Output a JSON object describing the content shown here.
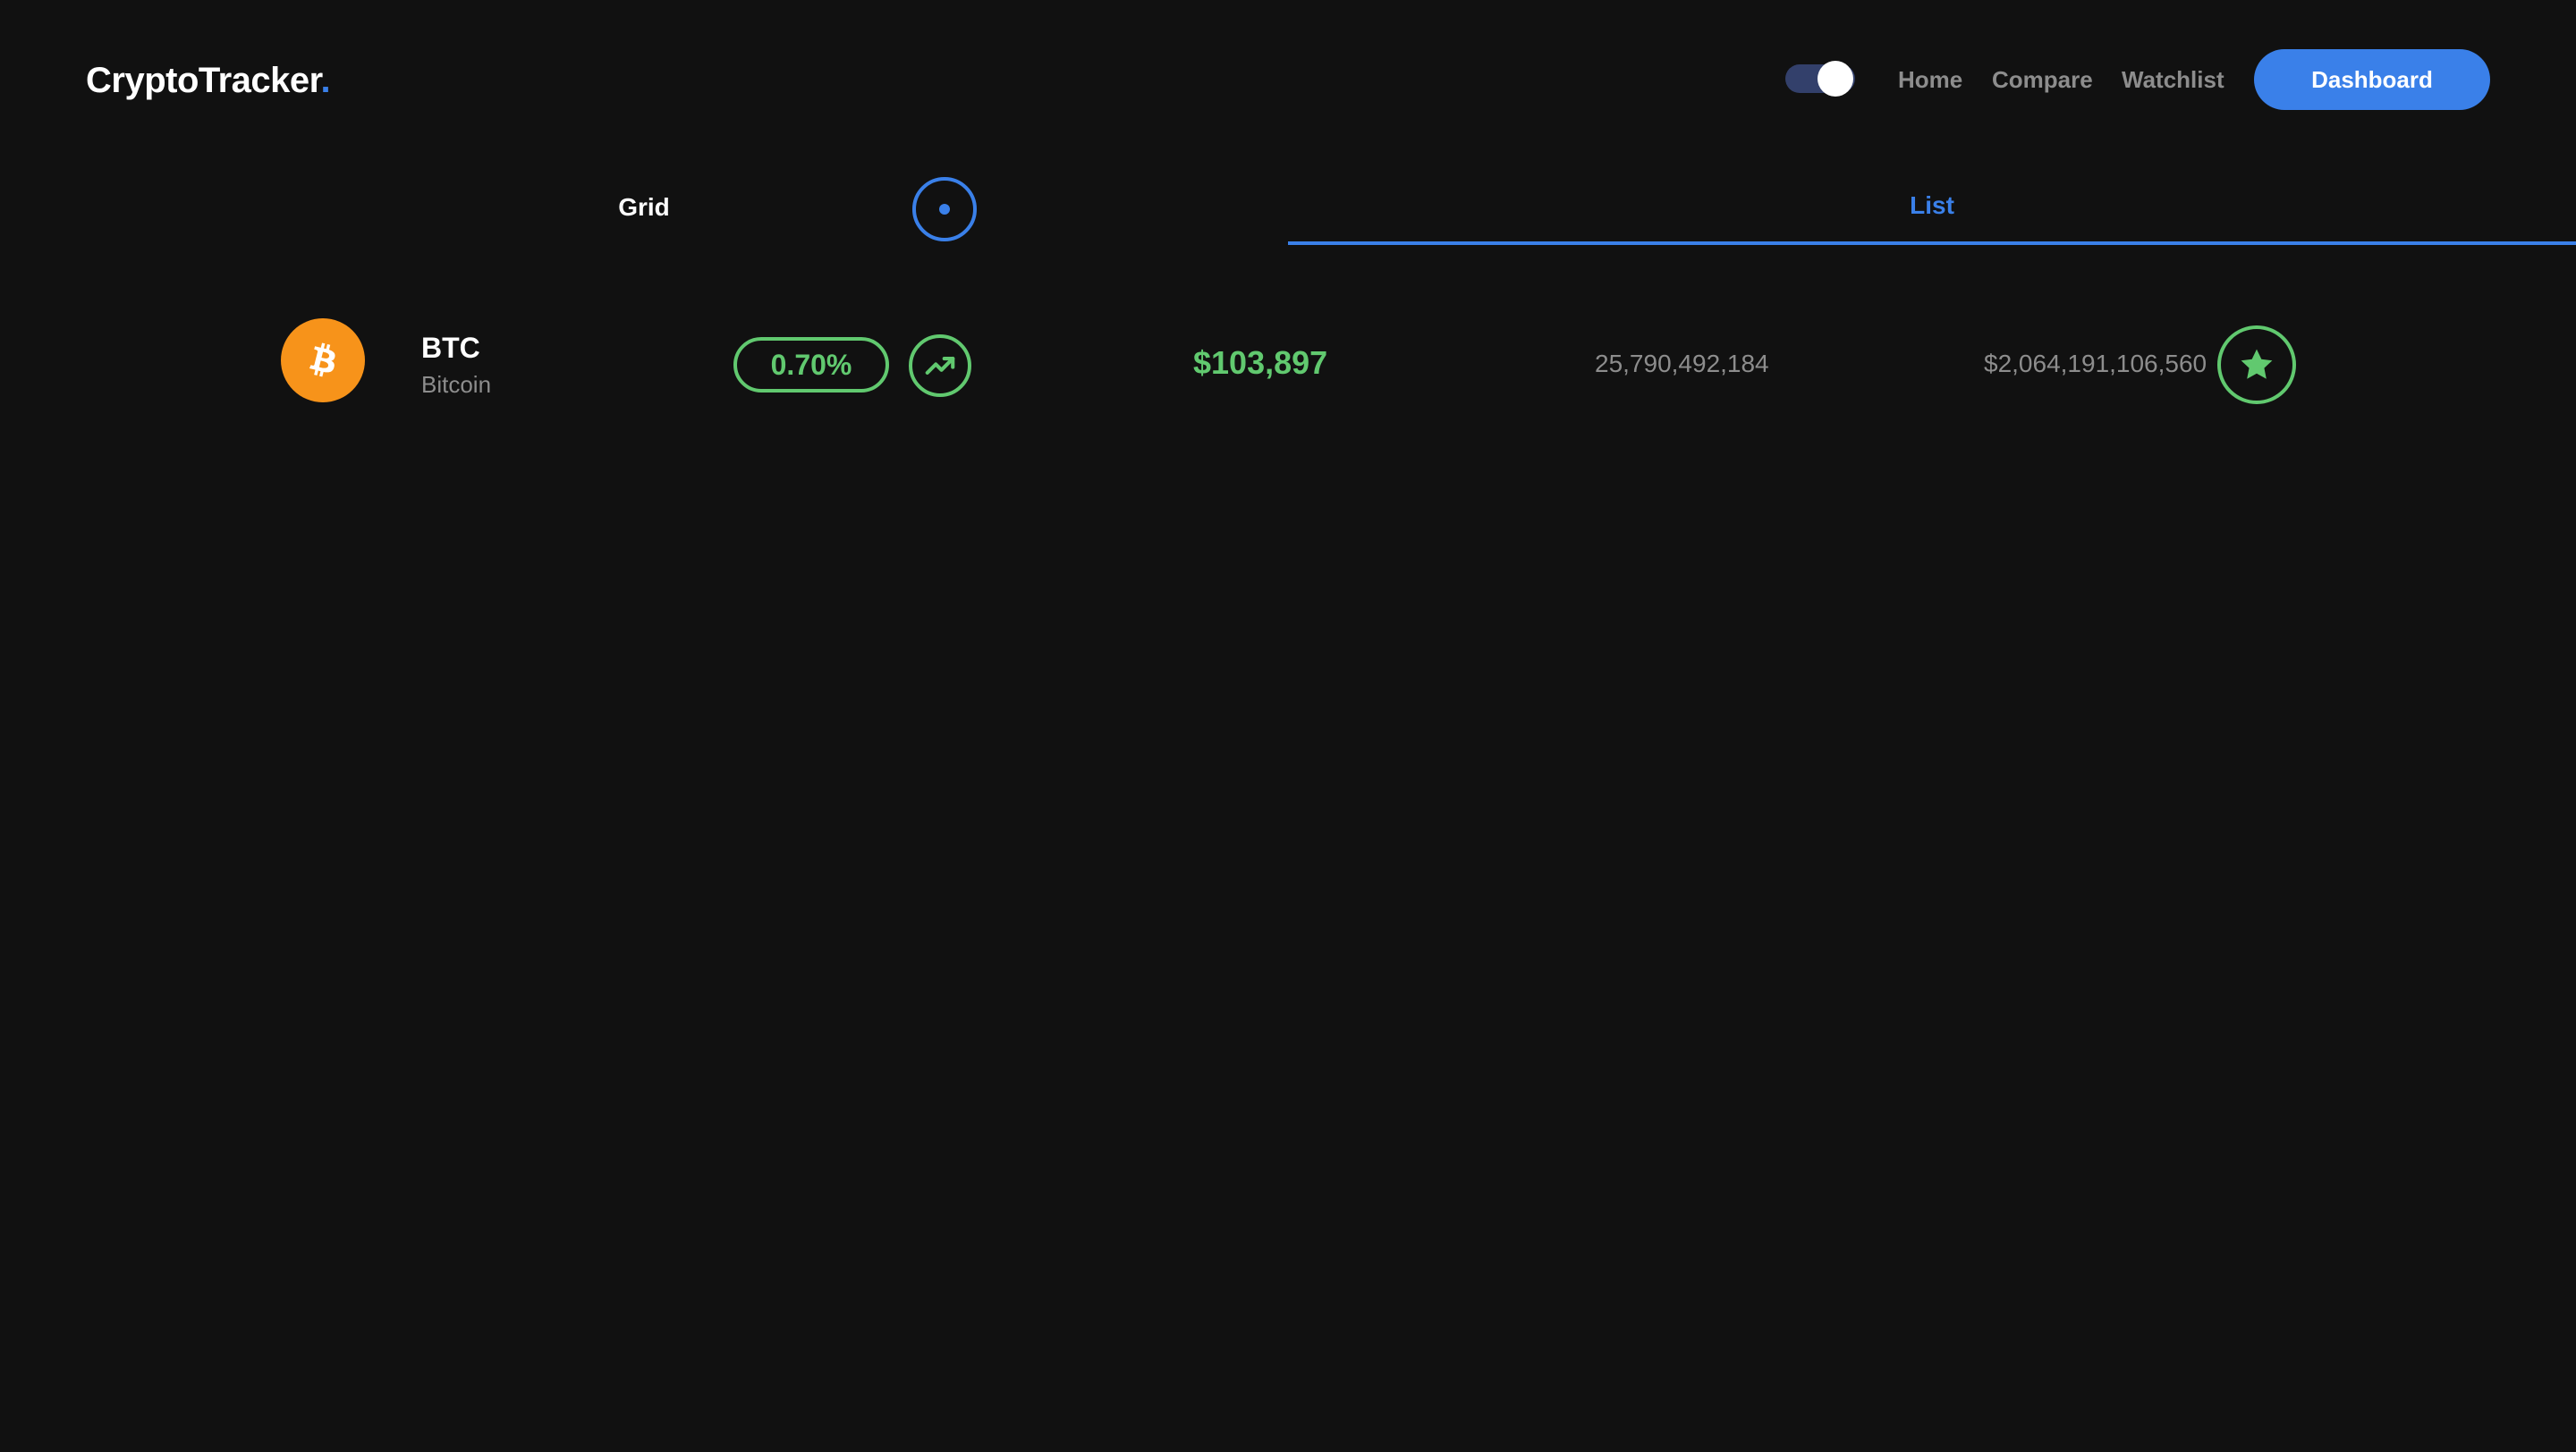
{
  "header": {
    "logo_text": "CryptoTracker",
    "logo_dot": ".",
    "nav": {
      "home": "Home",
      "compare": "Compare",
      "watchlist": "Watchlist"
    },
    "dashboard_label": "Dashboard",
    "theme_toggle_on": true
  },
  "tabs": {
    "grid_label": "Grid",
    "list_label": "List",
    "active": "List"
  },
  "coin": {
    "symbol": "BTC",
    "name": "Bitcoin",
    "icon": "bitcoin-icon",
    "change_percent": "0.70%",
    "trend": "trending-up-icon",
    "price": "$103,897",
    "volume": "25,790,492,184",
    "market_cap": "$2,064,191,106,560",
    "watch_icon": "star-icon"
  },
  "colors": {
    "background": "#111111",
    "accent_blue": "#3a80e9",
    "positive_green": "#61c96f",
    "bitcoin_orange": "#f7931a",
    "muted_text": "#8d8d8d"
  }
}
